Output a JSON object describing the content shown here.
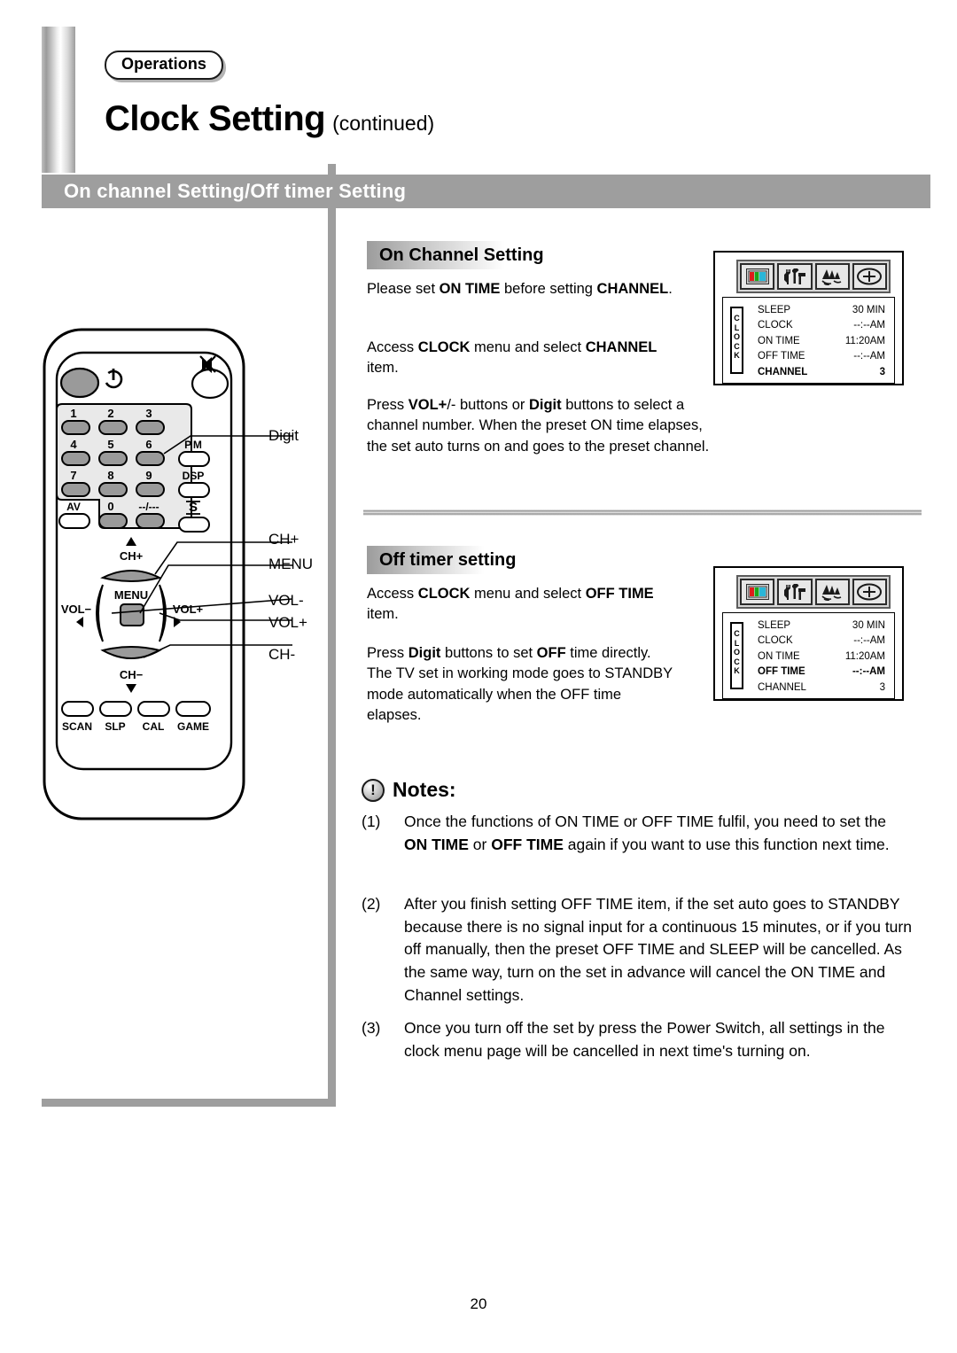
{
  "header": {
    "tab_label": "Operations",
    "title_main": "Clock Setting",
    "title_sub": "(continued)",
    "band_label": "On channel Setting/Off timer Setting"
  },
  "sections": {
    "on_channel": {
      "heading": "On Channel Setting",
      "paragraphs": [
        "Please set ON TIME before setting CHANNEL.",
        "Access CLOCK menu and select CHANNEL item.",
        "Press VOL+/- buttons or Digit buttons to select a channel number. When the preset ON time elapses, the set auto turns on and goes to the preset channel."
      ]
    },
    "off_timer": {
      "heading": "Off timer setting",
      "paragraphs": [
        "Access CLOCK menu and select OFF TIME item.",
        "Press Digit buttons to set OFF time directly. The TV set in working mode goes to STANDBY mode automatically when the OFF time elapses."
      ]
    }
  },
  "osd_screens": [
    {
      "name": "on-channel-osd",
      "icons": [
        "picture-icon",
        "tools-icon",
        "sound-icon",
        "clock-icon"
      ],
      "side_tab": "CLOCK",
      "rows": [
        {
          "label": "SLEEP",
          "value": "30 MIN",
          "highlighted": false
        },
        {
          "label": "CLOCK",
          "value": "--:--AM",
          "highlighted": false
        },
        {
          "label": "ON TIME",
          "value": "11:20AM",
          "highlighted": false
        },
        {
          "label": "OFF TIME",
          "value": "--:--AM",
          "highlighted": false
        },
        {
          "label": "CHANNEL",
          "value": "3",
          "highlighted": true
        }
      ]
    },
    {
      "name": "off-timer-osd",
      "icons": [
        "picture-icon",
        "tools-icon",
        "sound-icon",
        "clock-icon"
      ],
      "side_tab": "CLOCK",
      "rows": [
        {
          "label": "SLEEP",
          "value": "30 MIN",
          "highlighted": false
        },
        {
          "label": "CLOCK",
          "value": "--:--AM",
          "highlighted": false
        },
        {
          "label": "ON TIME",
          "value": "11:20AM",
          "highlighted": false
        },
        {
          "label": "OFF TIME",
          "value": "--:--AM",
          "highlighted": true
        },
        {
          "label": "CHANNEL",
          "value": "3",
          "highlighted": false
        }
      ]
    }
  ],
  "notes": {
    "icon": "exclamation-icon",
    "title": "Notes:",
    "items": [
      {
        "num": "(1)",
        "text": "Once the functions of ON TIME or OFF TIME fulfil, you need to set the ON TIME or OFF TIME again if you want to use this function next time."
      },
      {
        "num": "(2)",
        "text": "After you finish setting OFF TIME item, if the set auto goes to STANDBY because there is no signal input for a continuous 15 minutes, or if you turn off manually, then the preset OFF TIME and SLEEP will be cancelled. As the same way, turn on the set in advance will cancel the ON TIME and Channel settings."
      },
      {
        "num": "(3)",
        "text": "Once you turn off the set by press the Power Switch, all settings in the clock menu page will be cancelled in next time's turning on."
      }
    ]
  },
  "remote": {
    "power_icon": "power-icon",
    "mute_icon": "mute-icon",
    "digits": [
      "1",
      "2",
      "3",
      "4",
      "5",
      "6",
      "7",
      "8",
      "9"
    ],
    "av_label": "AV",
    "zero_label": "0",
    "dash_label": "--/---",
    "side_keys": [
      "P.M",
      "DSP",
      "S"
    ],
    "ch_up_label": "CH+",
    "ch_down_label": "CH−",
    "vol_down_label": "VOL−",
    "vol_up_label": "VOL+",
    "menu_label": "MENU",
    "bottom_keys": [
      "SCAN",
      "SLP",
      "CAL",
      "GAME"
    ]
  },
  "callouts": [
    {
      "label": "Digit"
    },
    {
      "label": "CH+"
    },
    {
      "label": "MENU"
    },
    {
      "label": "VOL-"
    },
    {
      "label": "VOL+"
    },
    {
      "label": "CH-"
    }
  ],
  "footer": {
    "page_number": "20"
  },
  "colors": {
    "band_gray": "#9e9e9e",
    "key_gray": "#9a9a9a",
    "osd_red": "#e01b1b",
    "osd_green": "#1aa51a",
    "osd_cyan": "#29b6d8"
  }
}
